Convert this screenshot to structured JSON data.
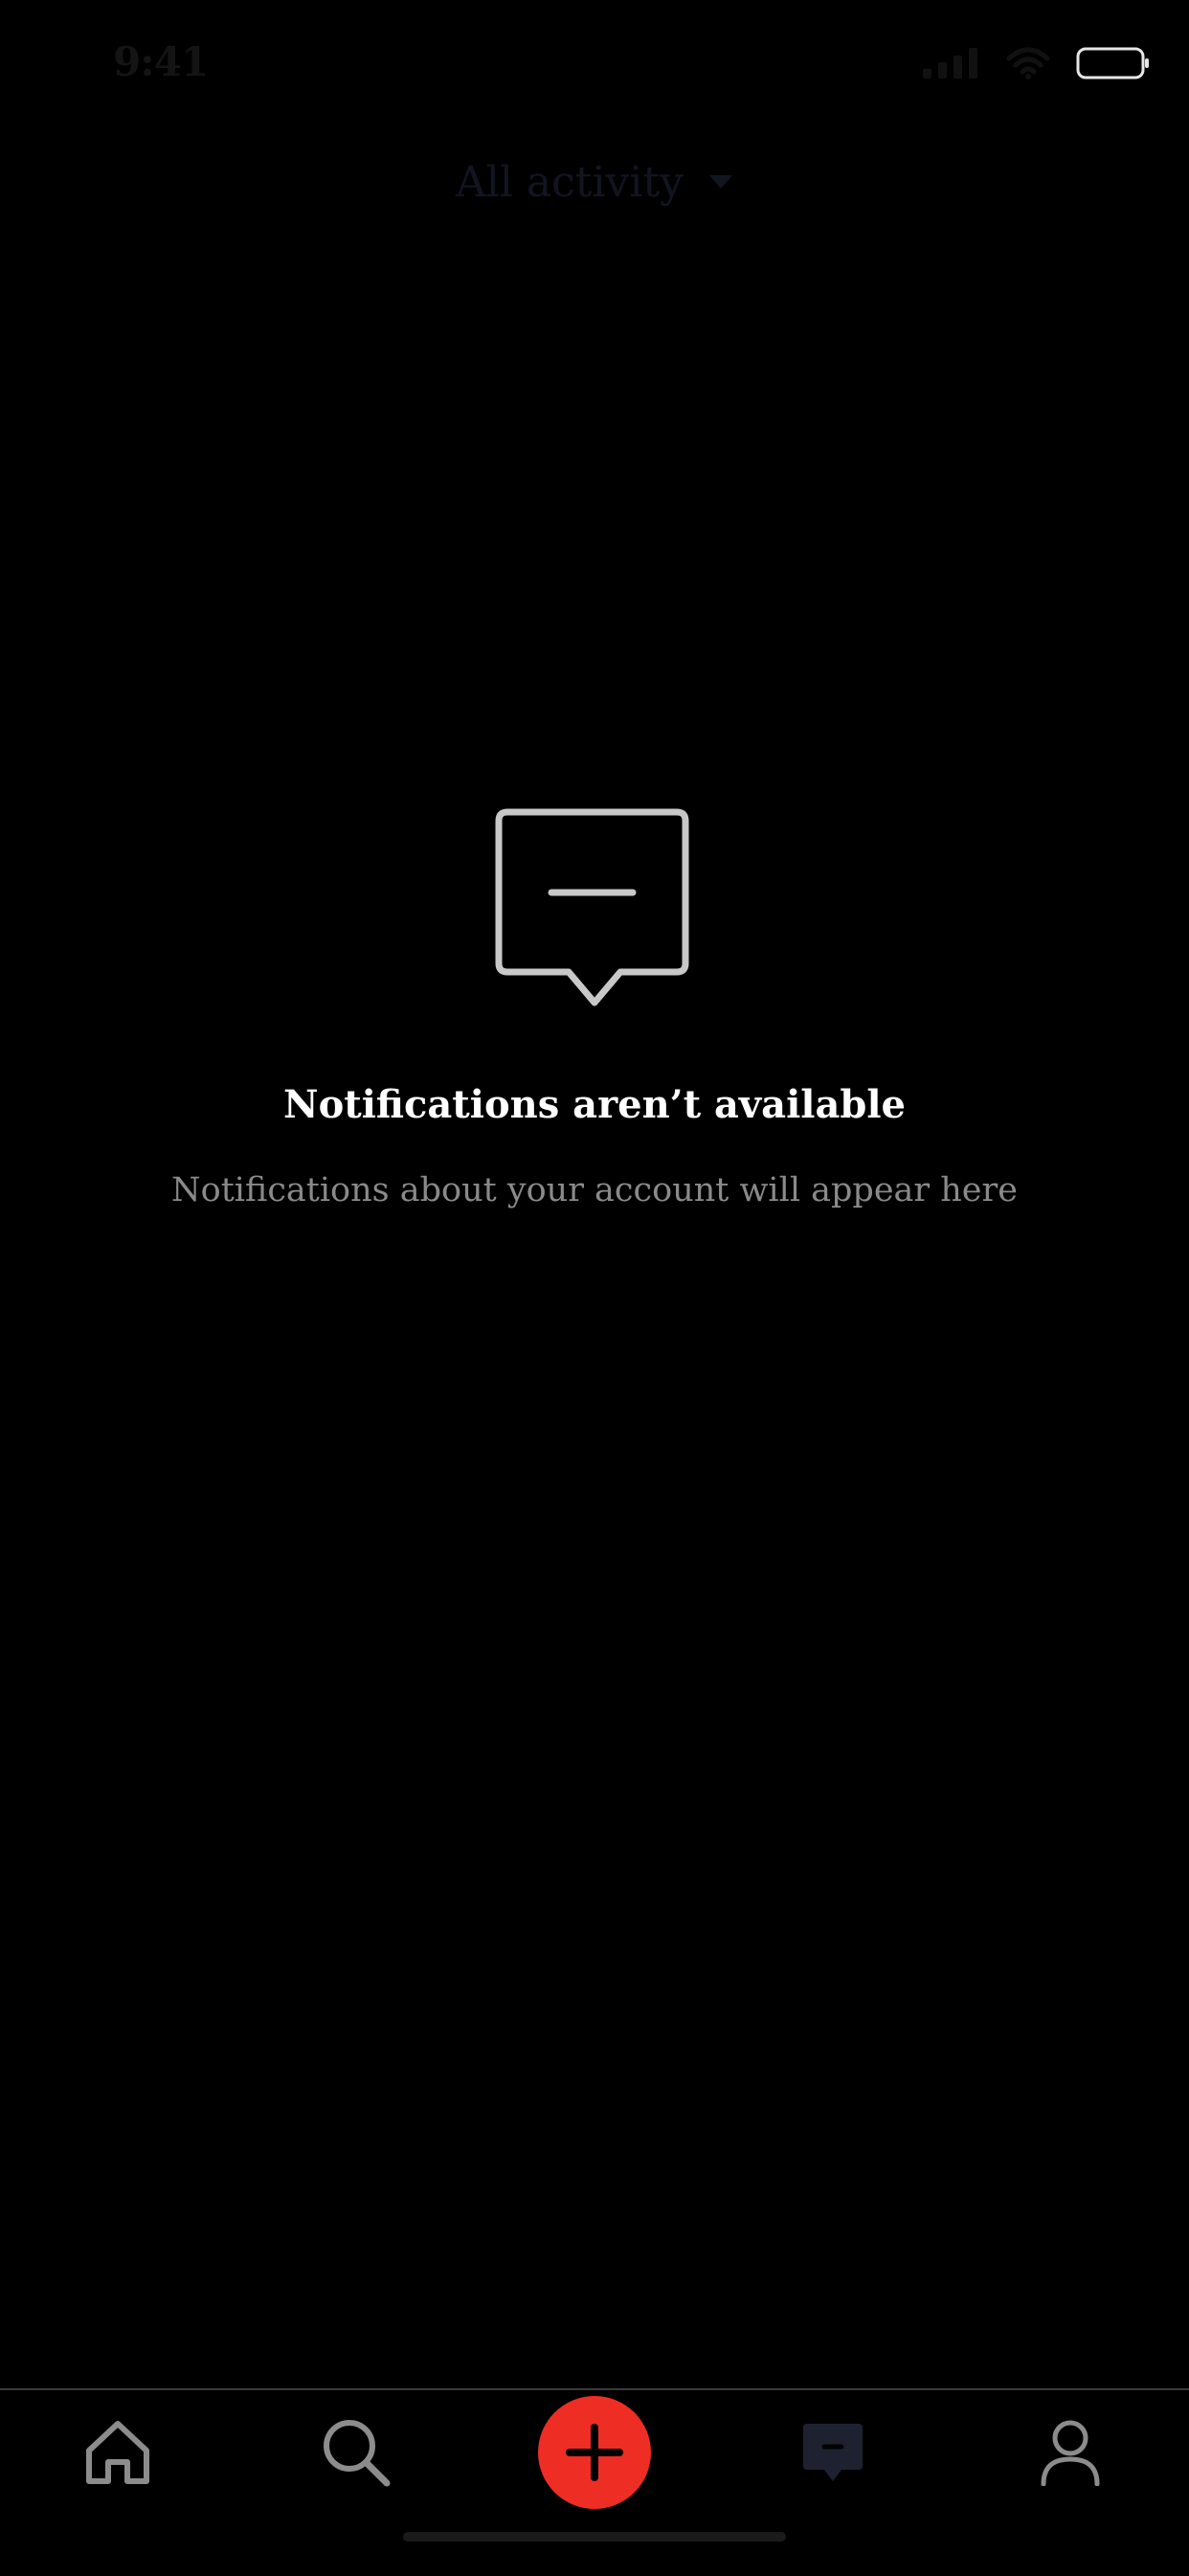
{
  "status_bar": {
    "time": "9:41",
    "signal_icon": "cellular-signal-icon",
    "wifi_icon": "wifi-icon",
    "battery_icon": "battery-icon"
  },
  "header": {
    "title": "All activity",
    "dropdown_icon": "caret-down-icon"
  },
  "empty_state": {
    "icon": "message-bubble-icon",
    "title": "Notifications aren’t available",
    "subtitle": "Notifications about your account will appear here"
  },
  "tab_bar": {
    "items": [
      {
        "name": "home",
        "icon": "home-icon"
      },
      {
        "name": "search",
        "icon": "search-icon"
      },
      {
        "name": "create",
        "icon": "plus-icon"
      },
      {
        "name": "notifications",
        "icon": "message-icon",
        "selected": true
      },
      {
        "name": "profile",
        "icon": "person-icon"
      }
    ]
  },
  "colors": {
    "background": "#000000",
    "accent": "#ee2d24",
    "muted_text": "#8a8a8a",
    "icon_gray": "#8c8c8c",
    "selected_tab": "#1e2230"
  }
}
